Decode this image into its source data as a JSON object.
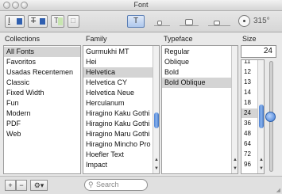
{
  "window": {
    "title": "Font"
  },
  "toolbar": {
    "underline_glyph": "I",
    "strike_glyph": "T",
    "text_color_glyph": "T",
    "doc_color_glyph": "□",
    "shadow_glyph": "T",
    "angle": "315°",
    "text_color_swatch": "#2f5fb0",
    "doc_swatch": "#c8e6b0"
  },
  "headers": {
    "collections": "Collections",
    "family": "Family",
    "typeface": "Typeface",
    "size": "Size"
  },
  "collections": [
    "All Fonts",
    "Favoritos",
    "Usadas Recentemen",
    "Classic",
    "Fixed Width",
    "Fun",
    "Modern",
    "PDF",
    "Web"
  ],
  "families": [
    "Gurmukhi MT",
    "Hei",
    "Helvetica",
    "Helvetica CY",
    "Helvetica Neue",
    "Herculanum",
    "Hiragino Kaku Gothi",
    "Hiragino Kaku Gothi",
    "Hiragino Maru Gothi",
    "Hiragino Mincho Pro",
    "Hoefler Text",
    "Impact"
  ],
  "typefaces": [
    "Regular",
    "Oblique",
    "Bold",
    "Bold Oblique"
  ],
  "size": {
    "value": "24",
    "list": [
      "11",
      "12",
      "13",
      "14",
      "18",
      "24",
      "36",
      "48",
      "64",
      "72",
      "96"
    ]
  },
  "bottom": {
    "add": "+",
    "remove": "−",
    "action": "⚙▾",
    "search_placeholder": "Search"
  }
}
